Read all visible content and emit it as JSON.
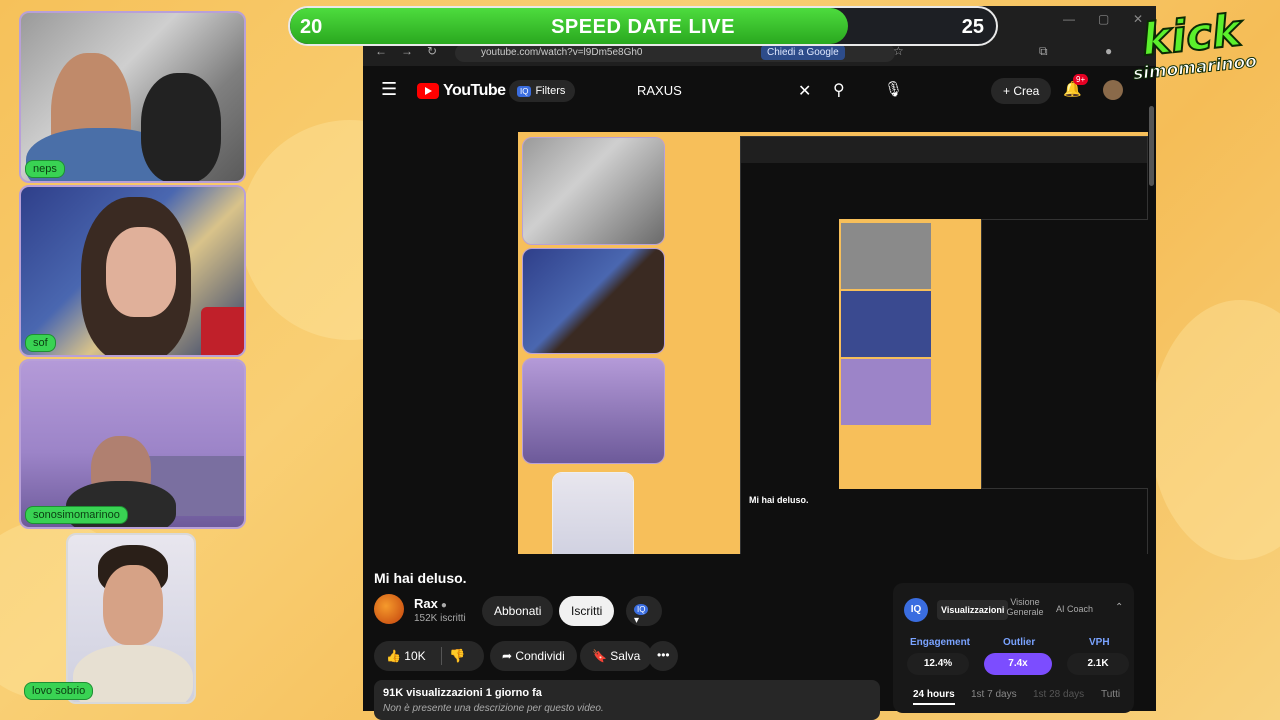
{
  "overlay": {
    "timer_left": "20",
    "timer_right": "25",
    "timer_progress_fraction": 0.79,
    "title": "SPEED DATE LIVE",
    "kick_logo_word": "kick",
    "kick_logo_user": "simomarinoo"
  },
  "cams": [
    {
      "tag": "neps"
    },
    {
      "tag": "sof"
    },
    {
      "tag": "sonosimomarinoo"
    },
    {
      "tag": "lovo sobrio"
    }
  ],
  "browser": {
    "url": "youtube.com/watch?v=l9Dm5e8Gh0",
    "chiedi_label": "Chiedi a Google"
  },
  "youtube": {
    "logo_text": "YouTube",
    "filters_label": "Filters",
    "search_query": "RAXUS",
    "crea_label": "Crea",
    "notif_count": "9+",
    "video_title": "Mi hai deluso.",
    "channel_name": "Rax",
    "channel_subs": "152K iscritti",
    "abbonati_label": "Abbonati",
    "iscritti_label": "Iscritti",
    "like_count": "10K",
    "share_label": "Condividi",
    "save_label": "Salva",
    "desc_stats": "91K visualizzazioni  1 giorno fa",
    "desc_text": "Non è presente una descrizione per questo video."
  },
  "stats": {
    "logo": "IQ",
    "tab_views": "Visualizzazioni",
    "tab_overview": "Visione Generale",
    "tab_ai": "AI Coach",
    "engagement_label": "Engagement",
    "engagement_value": "12.4%",
    "outlier_label": "Outlier",
    "outlier_value": "7.4x",
    "vph_label": "VPH",
    "vph_value": "2.1K",
    "range_24h": "24 hours",
    "range_7d": "1st 7 days",
    "range_28d": "1st 28 days",
    "range_all": "Tutti"
  },
  "colors": {
    "green": "#39d353",
    "purple": "#7c4dff",
    "yt_red": "#ff0000"
  }
}
